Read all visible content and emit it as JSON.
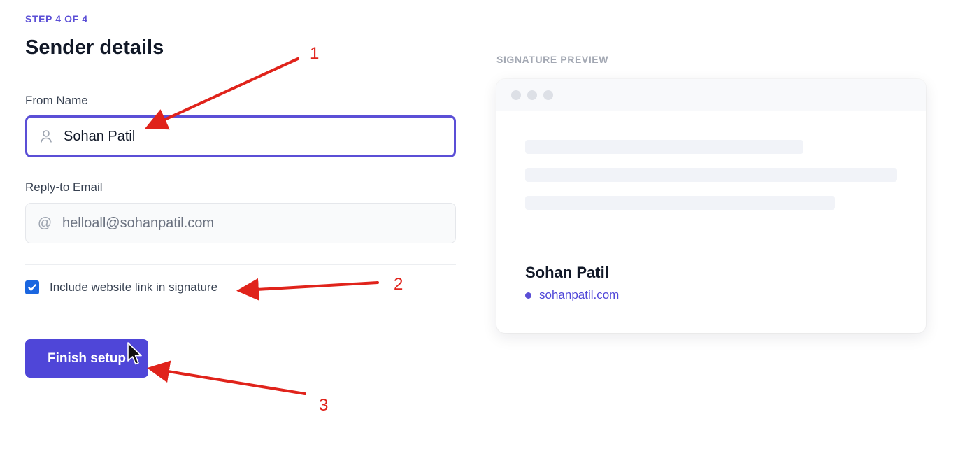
{
  "form": {
    "step": "STEP 4 OF 4",
    "title": "Sender details",
    "from_name_label": "From Name",
    "from_name_value": "Sohan Patil",
    "reply_to_label": "Reply-to Email",
    "reply_to_value": "helloall@sohanpatil.com",
    "include_link_label": "Include website link in signature",
    "include_link_checked": true,
    "finish_button": "Finish setup"
  },
  "preview": {
    "label": "SIGNATURE PREVIEW",
    "name": "Sohan Patil",
    "website": "sohanpatil.com"
  },
  "annotations": [
    "1",
    "2",
    "3"
  ],
  "icons": {
    "from_name": "user-icon",
    "reply_to": "at-sign-icon",
    "checkbox": "checkmark-icon",
    "cursor": "mouse-cursor-icon"
  },
  "colors": {
    "accent": "#4f46d8",
    "checkbox": "#1a66e0",
    "annotation": "#e0231b"
  }
}
